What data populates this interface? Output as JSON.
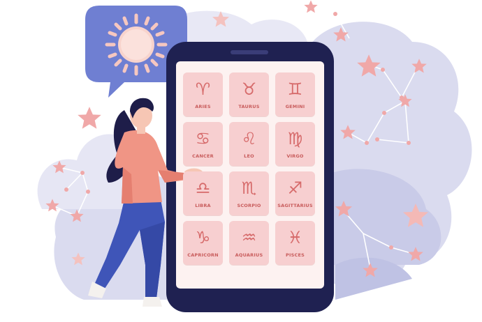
{
  "zodiac": {
    "signs": [
      {
        "label": "ARIES",
        "glyph": "♈"
      },
      {
        "label": "TAURUS",
        "glyph": "♉"
      },
      {
        "label": "GEMINI",
        "glyph": "♊"
      },
      {
        "label": "CANCER",
        "glyph": "♋"
      },
      {
        "label": "LEO",
        "glyph": "♌"
      },
      {
        "label": "VIRGO",
        "glyph": "♍"
      },
      {
        "label": "LIBRA",
        "glyph": "♎"
      },
      {
        "label": "SCORPIO",
        "glyph": "♏"
      },
      {
        "label": "SAGITTARIUS",
        "glyph": "♐"
      },
      {
        "label": "CAPRICORN",
        "glyph": "♑"
      },
      {
        "label": "AQUARIUS",
        "glyph": "♒"
      },
      {
        "label": "PISCES",
        "glyph": "♓"
      }
    ]
  },
  "icons": {
    "bubble": "sun-icon",
    "decor": "star-icon"
  },
  "colors": {
    "phone_frame": "#1f2151",
    "screen": "#fdf2f1",
    "tile": "#f7cfd0",
    "accent": "#d66a6a",
    "cloud": "#dadbef",
    "star": "#f0a8a8",
    "bubble": "#6f7fd2",
    "shirt": "#f09585",
    "pants": "#3f55b8",
    "hair": "#1e1d49"
  }
}
